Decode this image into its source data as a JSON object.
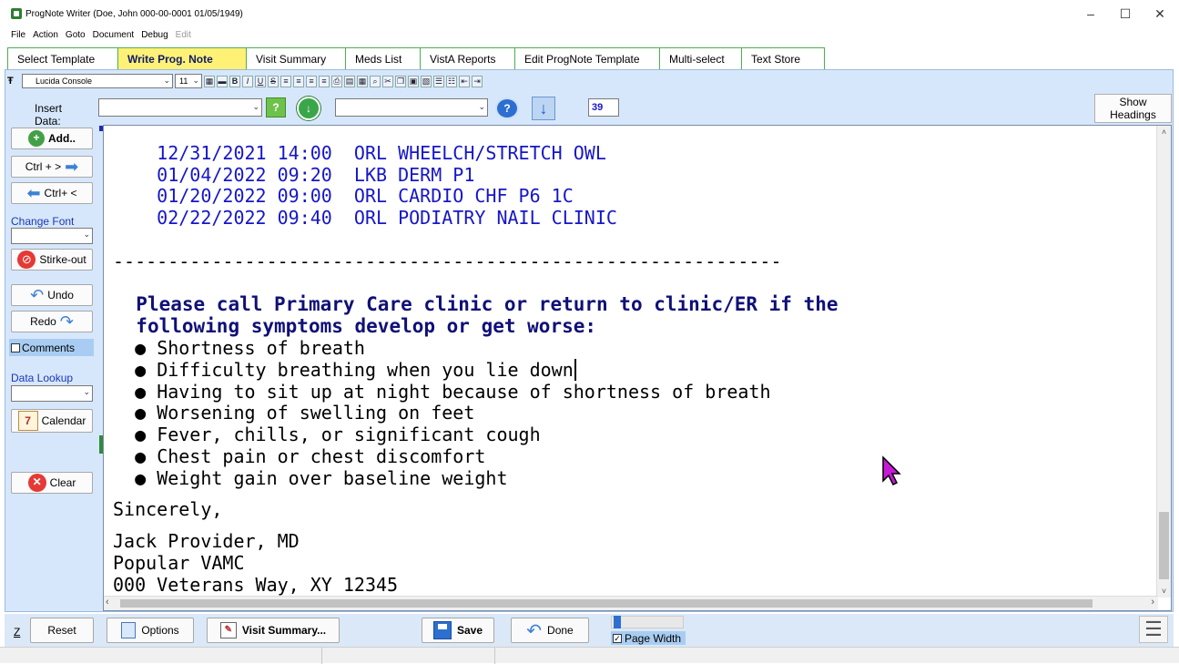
{
  "window": {
    "title": "ProgNote Writer (Doe, John  000-00-0001  01/05/1949)",
    "controls": [
      "–",
      "☐",
      "✕"
    ]
  },
  "menu": [
    "File",
    "Action",
    "Goto",
    "Document",
    "Debug",
    "Edit"
  ],
  "tabs": [
    "Select Template",
    "Write Prog. Note",
    "Visit Summary",
    "Meds List",
    "VistA Reports",
    "Edit ProgNote Template",
    "Multi-select",
    "Text Store"
  ],
  "active_tab": "Write Prog. Note",
  "format_toolbar": {
    "font_name": "Lucida Console",
    "font_size": "11",
    "buttons": [
      "B",
      "I",
      "U",
      "S"
    ]
  },
  "insert_row": {
    "label": "Insert Data:",
    "line_number": "39",
    "show_headings": "Show\nHeadings"
  },
  "sidebar": {
    "add": "Add..",
    "ctrl_right": "Ctrl + >",
    "ctrl_left": "Ctrl+ <",
    "change_font": "Change Font",
    "strike_out": "Stirke-out",
    "undo": "Undo",
    "redo": "Redo",
    "comments": "Comments",
    "data_lookup": "Data Lookup",
    "calendar": "Calendar",
    "calendar_icon_num": "7",
    "clear": "Clear"
  },
  "note": {
    "appointments": [
      "12/31/2021 14:00  ORL WHEELCH/STRETCH OWL",
      "01/04/2022 09:20  LKB DERM P1",
      "01/20/2022 09:00  ORL CARDIO CHF P6 1C",
      "02/22/2022 09:40  ORL PODIATRY NAIL CLINIC"
    ],
    "separator": "-------------------------------------------------------------",
    "heading_line1": "Please call Primary Care clinic or return to clinic/ER if the",
    "heading_line2": "following symptoms develop or get worse:",
    "bullet": "●",
    "symptoms": [
      "Shortness of breath",
      "Difficulty breathing when you lie down",
      "Having to sit up at night because of shortness of breath",
      "Worsening of swelling on feet",
      "Fever, chills, or significant cough",
      "Chest pain or chest discomfort",
      "Weight gain over baseline weight"
    ],
    "closing": "Sincerely,",
    "signature": [
      "Jack Provider, MD",
      "Popular VAMC",
      "000 Veterans Way, XY 12345"
    ]
  },
  "bottom": {
    "z": "Z",
    "reset": "Reset",
    "options": "Options",
    "visit_summary": "Visit Summary...",
    "save": "Save",
    "done": "Done",
    "page_width": "Page Width"
  },
  "colors": {
    "tab_active": "#fff176",
    "tab_border": "#4caf50",
    "panel": "#d7e7fb",
    "note_blue": "#1616c8",
    "heading_navy": "#101078"
  }
}
